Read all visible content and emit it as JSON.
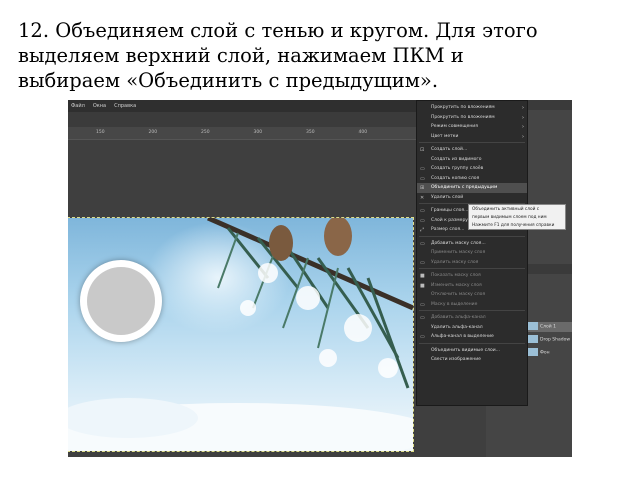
{
  "caption": {
    "text": "12. Объединяем слой с тенью и кругом. Для этого\nвыделяем верхний слой, нажимаем ПКМ и\nвыбираем «Объединить с предыдущим»."
  },
  "app": {
    "menubar": [
      "Файл",
      "Окна",
      "Справка"
    ],
    "ruler_ticks": [
      {
        "label": "150",
        "xf": 0.08
      },
      {
        "label": "200",
        "xf": 0.23
      },
      {
        "label": "250",
        "xf": 0.38
      },
      {
        "label": "300",
        "xf": 0.53
      },
      {
        "label": "350",
        "xf": 0.68
      },
      {
        "label": "400",
        "xf": 0.83
      }
    ],
    "context_menu": {
      "items": [
        {
          "icon": "",
          "label": "Прокрутить по вложениям",
          "arrow": "›"
        },
        {
          "icon": "",
          "label": "Прокрутить по вложениям",
          "arrow": "›"
        },
        {
          "icon": "",
          "label": "Режим совмещения",
          "arrow": "›"
        },
        {
          "icon": "",
          "label": "Цвет метки",
          "arrow": "›"
        },
        {
          "sep": true
        },
        {
          "icon": "⊡",
          "label": "Создать слой..."
        },
        {
          "icon": "",
          "label": "Создать из видимого"
        },
        {
          "icon": "▭",
          "label": "Создать группу слоёв"
        },
        {
          "icon": "▭",
          "label": "Создать копию слоя"
        },
        {
          "icon": "⊞",
          "label": "Объединить с предыдущим",
          "hl": true
        },
        {
          "icon": "✕",
          "label": "Удалить слой"
        },
        {
          "sep": true
        },
        {
          "icon": "▭",
          "label": "Границы слоя..."
        },
        {
          "icon": "▭",
          "label": "Слой к размеру изображения"
        },
        {
          "icon": "⤢",
          "label": "Размер слоя..."
        },
        {
          "sep": true
        },
        {
          "icon": "▭",
          "label": "Добавить маску слоя..."
        },
        {
          "icon": "",
          "label": "Применить маску слоя",
          "dim": true
        },
        {
          "icon": "▭",
          "label": "Удалить маску слоя",
          "dim": true
        },
        {
          "sep": true
        },
        {
          "icon": "■",
          "label": "Показать маску слоя",
          "dim": true
        },
        {
          "icon": "■",
          "label": "Изменить маску слоя",
          "dim": true
        },
        {
          "icon": "",
          "label": "Отключить маску слоя",
          "dim": true
        },
        {
          "icon": "▭",
          "label": "Маску в выделение",
          "dim": true
        },
        {
          "sep": true
        },
        {
          "icon": "▭",
          "label": "Добавить альфа-канал",
          "dim": true
        },
        {
          "icon": "",
          "label": "Удалить альфа-канал"
        },
        {
          "icon": "▭",
          "label": "Альфа-канал в выделение"
        },
        {
          "sep": true
        },
        {
          "icon": "",
          "label": "Объединить видимые слои..."
        },
        {
          "icon": "",
          "label": "Свести изображение"
        }
      ]
    },
    "tooltip": {
      "lines": [
        "Объединить активный слой с",
        "первым видимым слоем под ним",
        "Нажмите F1 для получения справки"
      ]
    },
    "layers": [
      {
        "label": "Слой 1",
        "selected": true
      },
      {
        "label": "Drop Shadow",
        "selected": false
      },
      {
        "label": "Фон",
        "selected": false
      }
    ],
    "colors": {
      "menu_bg": "#2c2c2c",
      "menu_highlight": "#4f4f4f",
      "panel_bg": "#454545"
    }
  }
}
